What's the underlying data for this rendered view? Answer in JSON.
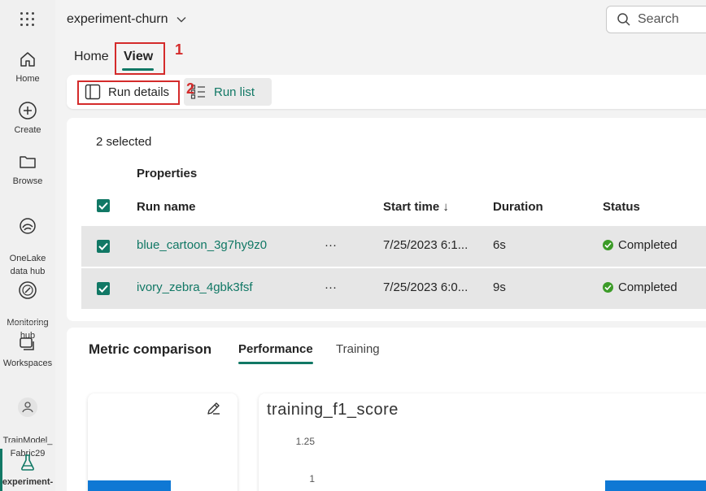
{
  "nav": {
    "items": [
      {
        "label": "Home"
      },
      {
        "label": "Create"
      },
      {
        "label": "Browse"
      },
      {
        "label": "OneLake\ndata hub"
      },
      {
        "label": "Monitoring\nhub"
      },
      {
        "label": "Workspaces"
      },
      {
        "label": "TrainModel_\nFabric29"
      },
      {
        "label": "experiment-"
      }
    ]
  },
  "header": {
    "workspace_title": "experiment-churn",
    "search_placeholder": "Search"
  },
  "tabs": {
    "home": "Home",
    "view": "View"
  },
  "callouts": {
    "one": "1",
    "two": "2"
  },
  "ribbon": {
    "run_details": "Run details",
    "run_list": "Run list"
  },
  "runs": {
    "selected_text": "2 selected",
    "properties_label": "Properties",
    "columns": {
      "run_name": "Run name",
      "start_time": "Start time ↓",
      "duration": "Duration",
      "status": "Status"
    },
    "rows": [
      {
        "name": "blue_cartoon_3g7hy9z0",
        "more": "···",
        "start_time": "7/25/2023 6:1...",
        "duration": "6s",
        "status": "Completed"
      },
      {
        "name": "ivory_zebra_4gbk3fsf",
        "more": "···",
        "start_time": "7/25/2023 6:0...",
        "duration": "9s",
        "status": "Completed"
      }
    ]
  },
  "metric": {
    "title": "Metric comparison",
    "tabs": {
      "performance": "Performance",
      "training": "Training"
    },
    "chart_title": "training_f1_score",
    "yticks": [
      "1.25",
      "1"
    ]
  },
  "colors": {
    "accent": "#117865",
    "status_ok": "#3c9b28",
    "bar": "#0f78d4",
    "callout": "#d42b2b"
  }
}
